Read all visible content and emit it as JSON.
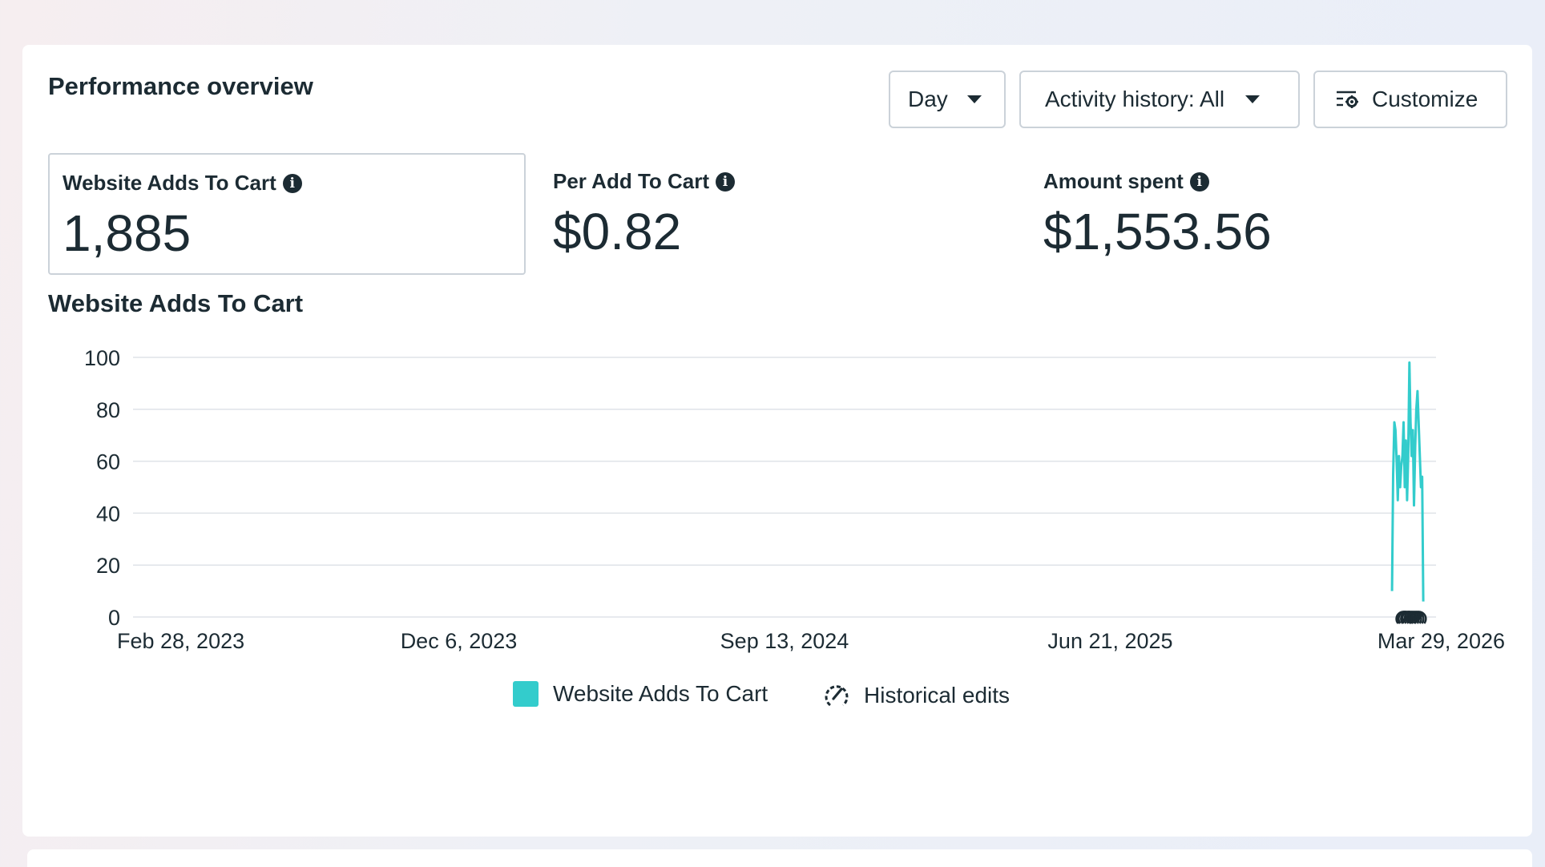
{
  "header": {
    "title": "Performance overview",
    "period_dropdown": "Day",
    "activity_dropdown": "Activity history: All",
    "customize_label": "Customize"
  },
  "metrics": [
    {
      "label": "Website Adds To Cart",
      "value": "1,885",
      "selected": true
    },
    {
      "label": "Per Add To Cart",
      "value": "$0.82",
      "selected": false
    },
    {
      "label": "Amount spent",
      "value": "$1,553.56",
      "selected": false
    }
  ],
  "chart_title": "Website Adds To Cart",
  "legend": {
    "series_label": "Website Adds To Cart",
    "edits_label": "Historical edits"
  },
  "colors": {
    "series": "#33cccc",
    "text": "#1c2b33",
    "border": "#cbd2d9"
  },
  "chart_data": {
    "type": "line",
    "y_ticks": [
      "100",
      "80",
      "60",
      "40",
      "20",
      "0"
    ],
    "x_ticks": [
      "Feb 28, 2023",
      "Dec 6, 2023",
      "Sep 13, 2024",
      "Jun 21, 2025",
      "Mar 29, 2026"
    ],
    "ylim": [
      0,
      100
    ],
    "xlim": [
      "2023-02-28",
      "2026-03-29"
    ],
    "grid": true,
    "legend_position": "bottom-center",
    "series": [
      {
        "name": "Website Adds To Cart",
        "color": "#33cccc",
        "x": [
          "2026-02-19",
          "2026-02-20",
          "2026-02-21",
          "2026-02-22",
          "2026-02-23",
          "2026-02-24",
          "2026-02-25",
          "2026-02-26",
          "2026-02-27",
          "2026-02-28",
          "2026-03-01",
          "2026-03-02",
          "2026-03-03",
          "2026-03-04",
          "2026-03-05",
          "2026-03-06",
          "2026-03-07",
          "2026-03-08",
          "2026-03-09",
          "2026-03-10",
          "2026-03-11",
          "2026-03-12",
          "2026-03-13",
          "2026-03-14",
          "2026-03-15",
          "2026-03-16",
          "2026-03-17",
          "2026-03-18"
        ],
        "y": [
          10,
          55,
          75,
          72,
          60,
          45,
          62,
          50,
          58,
          62,
          75,
          50,
          68,
          45,
          62,
          98,
          75,
          62,
          72,
          43,
          65,
          80,
          87,
          75,
          62,
          50,
          54,
          6
        ]
      }
    ],
    "edit_markers": [
      "2026-03-01",
      "2026-03-02",
      "2026-03-03",
      "2026-03-05",
      "2026-03-06",
      "2026-03-08",
      "2026-03-10",
      "2026-03-12",
      "2026-03-14"
    ]
  }
}
